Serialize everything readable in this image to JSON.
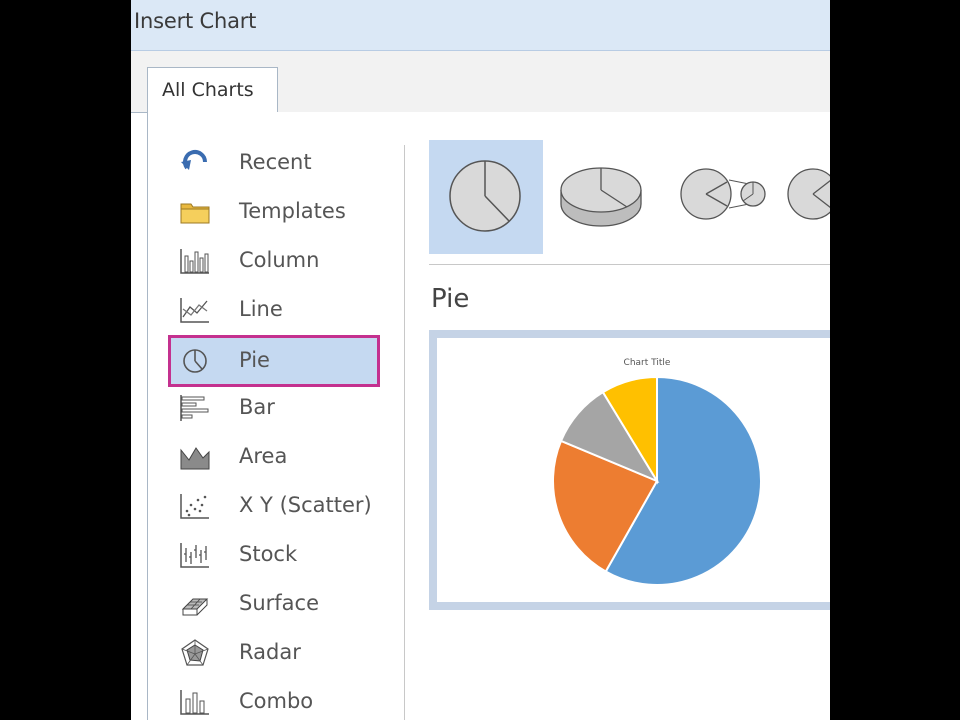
{
  "dialog": {
    "title": "Insert Chart",
    "tabs": [
      {
        "label": "All Charts"
      }
    ]
  },
  "categories": [
    {
      "label": "Recent",
      "icon": "recent-icon"
    },
    {
      "label": "Templates",
      "icon": "folder-icon"
    },
    {
      "label": "Column",
      "icon": "column-chart-icon"
    },
    {
      "label": "Line",
      "icon": "line-chart-icon"
    },
    {
      "label": "Pie",
      "icon": "pie-chart-icon",
      "selected": true
    },
    {
      "label": "Bar",
      "icon": "bar-chart-icon"
    },
    {
      "label": "Area",
      "icon": "area-chart-icon"
    },
    {
      "label": "X Y (Scatter)",
      "icon": "scatter-chart-icon"
    },
    {
      "label": "Stock",
      "icon": "stock-chart-icon"
    },
    {
      "label": "Surface",
      "icon": "surface-chart-icon"
    },
    {
      "label": "Radar",
      "icon": "radar-chart-icon"
    },
    {
      "label": "Combo",
      "icon": "combo-chart-icon"
    }
  ],
  "subtypes": [
    {
      "icon": "pie-icon",
      "selected": true
    },
    {
      "icon": "3d-pie-icon"
    },
    {
      "icon": "pie-of-pie-icon"
    },
    {
      "icon": "bar-of-pie-icon"
    }
  ],
  "subtype_title": "Pie",
  "colors": {
    "selection_fill": "#c5d9f1",
    "highlight_outline": "#c4318f",
    "slice_blue": "#5b9bd5",
    "slice_orange": "#ed7d31",
    "slice_gray": "#a5a5a5",
    "slice_yellow": "#ffc000"
  },
  "chart_data": {
    "type": "pie",
    "title": "Chart Title",
    "categories": [
      "",
      "",
      "",
      ""
    ],
    "values": [
      58.2,
      23.1,
      10,
      8.7
    ],
    "colors": [
      "#5b9bd5",
      "#ed7d31",
      "#a5a5a5",
      "#ffc000"
    ]
  }
}
